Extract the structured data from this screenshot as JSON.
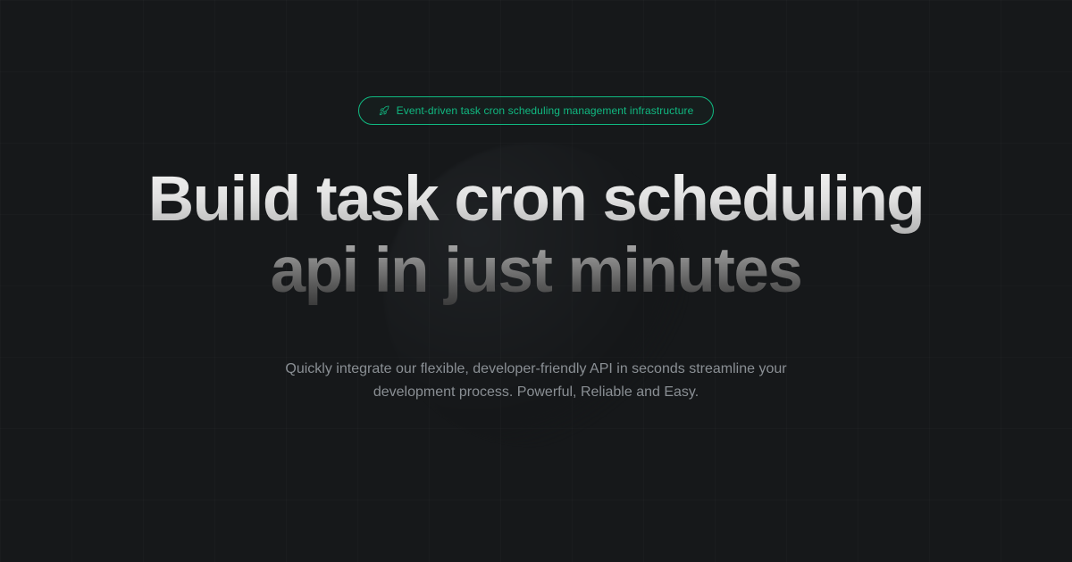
{
  "badge": {
    "label": "Event-driven task cron scheduling management infrastructure"
  },
  "headline": "Build task cron scheduling api in just minutes",
  "subtext": "Quickly integrate our flexible, developer-friendly API in seconds streamline your development process. Powerful, Reliable and Easy.",
  "colors": {
    "accent": "#10b981",
    "background": "#16181a"
  }
}
